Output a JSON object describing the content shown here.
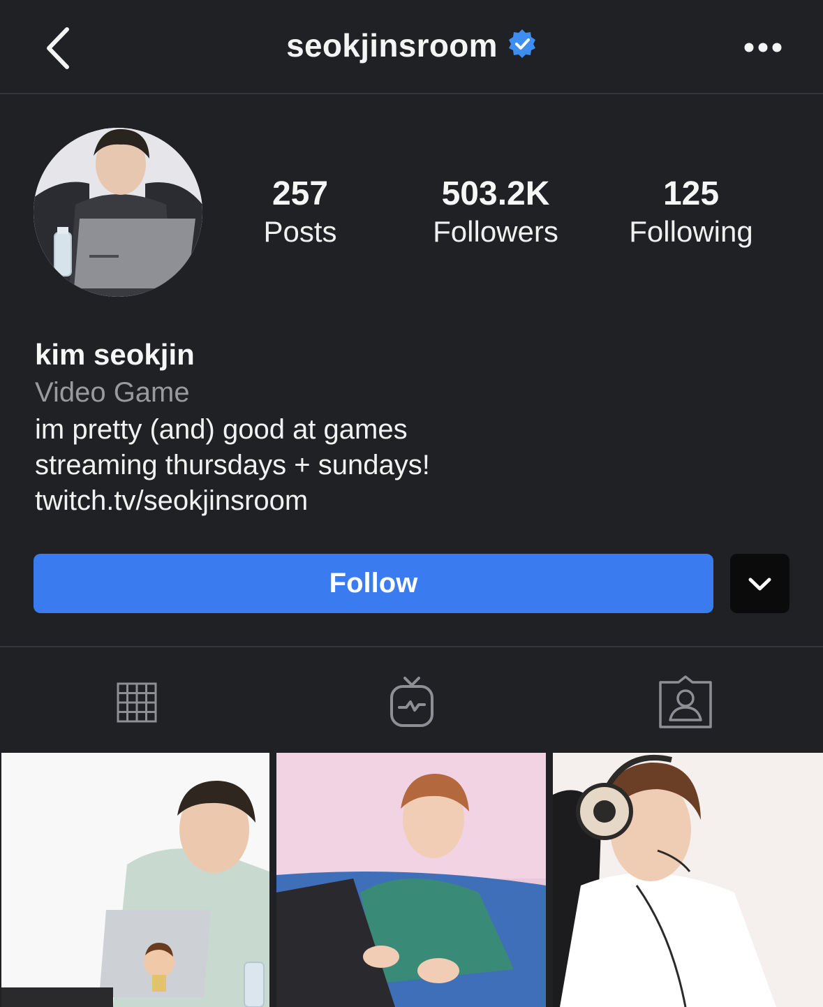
{
  "header": {
    "username": "seokjinsroom",
    "back_icon": "chevron-left-icon",
    "verified_icon": "verified-badge-icon",
    "more_icon": "more-horizontal-icon"
  },
  "stats": {
    "posts": {
      "value": "257",
      "label": "Posts"
    },
    "followers": {
      "value": "503.2K",
      "label": "Followers"
    },
    "following": {
      "value": "125",
      "label": "Following"
    }
  },
  "bio": {
    "name": "kim seokjin",
    "category": "Video Game",
    "line1": "im pretty (and) good at games",
    "line2": "streaming thursdays + sundays!",
    "link": "twitch.tv/seokjinsroom"
  },
  "actions": {
    "follow_label": "Follow",
    "dropdown_icon": "chevron-down-icon"
  },
  "tabs": [
    {
      "icon": "grid-icon"
    },
    {
      "icon": "igtv-icon"
    },
    {
      "icon": "tagged-user-icon"
    }
  ],
  "colors": {
    "background": "#202124",
    "follow_button": "#3a7bf0",
    "verified": "#3d8ef0",
    "muted_text": "#9a9a9e"
  }
}
